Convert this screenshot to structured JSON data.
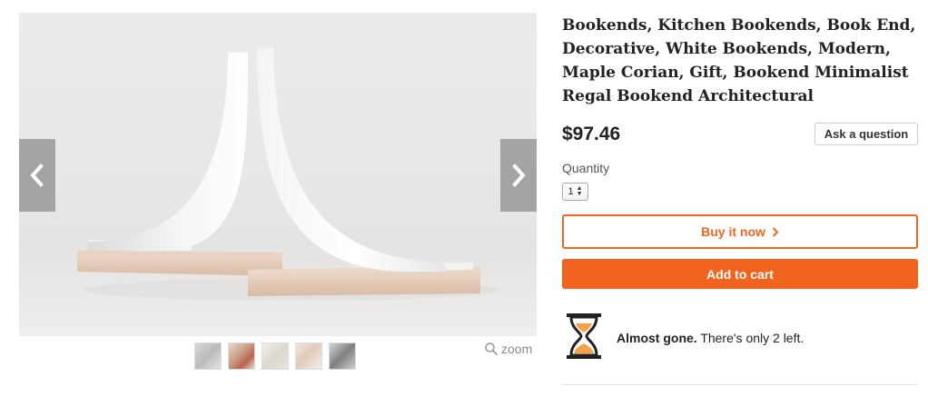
{
  "product": {
    "title": "Bookends, Kitchen Bookends, Book End, Decorative, White Bookends, Modern, Maple Corian, Gift, Bookend Minimalist Regal Bookend Architectural",
    "price": "$97.46"
  },
  "gallery": {
    "prev_icon": "chevron-left-icon",
    "next_icon": "chevron-right-icon",
    "thumbnail_count": 5,
    "zoom_label": "zoom"
  },
  "actions": {
    "ask_label": "Ask a question",
    "quantity_label": "Quantity",
    "quantity_value": "1",
    "buy_now_label": "Buy it now",
    "add_to_cart_label": "Add to cart"
  },
  "stock": {
    "headline": "Almost gone.",
    "detail": "There's only 2 left."
  },
  "colors": {
    "accent": "#f1641e",
    "text": "#222222"
  }
}
